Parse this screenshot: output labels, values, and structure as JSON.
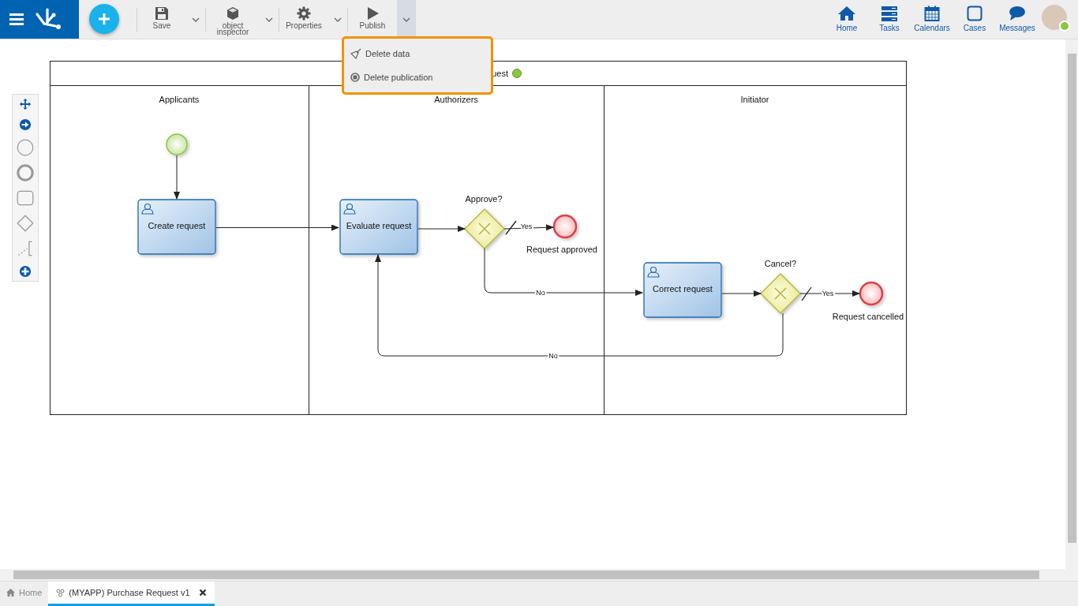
{
  "app_bar": {
    "toolbar": [
      {
        "label": "Save",
        "expanded": false
      },
      {
        "label": "object inspector",
        "expanded": false
      },
      {
        "label": "Properties",
        "expanded": false
      },
      {
        "label": "Publish",
        "expanded": true
      }
    ],
    "nav": [
      {
        "label": "Home"
      },
      {
        "label": "Tasks"
      },
      {
        "label": "Calendars"
      },
      {
        "label": "Cases"
      },
      {
        "label": "Messages"
      }
    ]
  },
  "publish_menu": {
    "items": [
      {
        "label": "Delete data"
      },
      {
        "label": "Delete publication"
      }
    ]
  },
  "diagram": {
    "pool_title": "uest",
    "lanes": [
      {
        "label": "Applicants"
      },
      {
        "label": "Authorizers"
      },
      {
        "label": "Initiator"
      }
    ],
    "nodes": [
      {
        "kind": "start"
      },
      {
        "kind": "task",
        "label": "Create request"
      },
      {
        "kind": "task",
        "label": "Evaluate request"
      },
      {
        "kind": "gateway",
        "label": "Approve?"
      },
      {
        "kind": "end",
        "label": "Request approved"
      },
      {
        "kind": "task",
        "label": "Correct request"
      },
      {
        "kind": "gateway",
        "label": "Cancel?"
      },
      {
        "kind": "end",
        "label": "Request cancelled"
      }
    ],
    "flows": [
      {
        "label": "Yes"
      },
      {
        "label": "No"
      },
      {
        "label": "Yes"
      },
      {
        "label": "No"
      }
    ]
  },
  "tabs": [
    {
      "label": "Home",
      "selected": false
    },
    {
      "label": "(MYAPP) Purchase Request v1",
      "selected": true
    }
  ]
}
